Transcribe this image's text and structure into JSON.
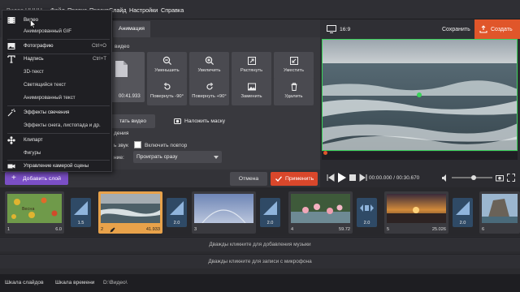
{
  "menubar": {
    "items": [
      "Видео HHHH",
      "Файл",
      "Правка",
      "Проект",
      "Слайд",
      "Настройки",
      "Справка"
    ]
  },
  "topright": {
    "aspect": "16:9",
    "save_label": "Сохранить",
    "create_label": "Создать"
  },
  "dropdown": {
    "items": [
      {
        "label": "Видео",
        "icon": "film-icon",
        "shortcut": ""
      },
      {
        "label": "Анимированный GIF",
        "icon": "",
        "shortcut": ""
      },
      {
        "label": "Фотографию",
        "icon": "image-icon",
        "shortcut": "Ctrl+O"
      },
      {
        "label": "Надпись",
        "icon": "text-icon",
        "shortcut": "Ctrl+T"
      },
      {
        "label": "3D-текст",
        "icon": "",
        "shortcut": ""
      },
      {
        "label": "Светящийся текст",
        "icon": "",
        "shortcut": ""
      },
      {
        "label": "Анимированный текст",
        "icon": "",
        "shortcut": ""
      },
      {
        "label": "Эффекты свечения",
        "icon": "sparkle-icon",
        "shortcut": ""
      },
      {
        "label": "Эффекты снега, листопада и др.",
        "icon": "",
        "shortcut": ""
      },
      {
        "label": "Клипарт",
        "icon": "flower-icon",
        "shortcut": ""
      },
      {
        "label": "Фигуры",
        "icon": "",
        "shortcut": ""
      },
      {
        "label": "Управление камерой сцены",
        "icon": "camera-icon",
        "shortcut": ""
      }
    ]
  },
  "tabs": {
    "animation": "Анимация",
    "video_fragment": "видео"
  },
  "tiles": [
    {
      "label": "Уменьшить",
      "icon": "zoom-out-icon"
    },
    {
      "label": "Увеличить",
      "icon": "zoom-in-icon"
    },
    {
      "label": "Растянуть",
      "icon": "stretch-icon"
    },
    {
      "label": "Уместить",
      "icon": "fit-icon"
    },
    {
      "label": "Повернуть -90°",
      "icon": "rotate-left-icon"
    },
    {
      "label": "Повернуть +90°",
      "icon": "rotate-right-icon"
    },
    {
      "label": "Заменить",
      "icon": "replace-icon"
    },
    {
      "label": "Удалить",
      "icon": "trash-icon"
    }
  ],
  "clip": {
    "duration": "00:41.933"
  },
  "buttons": {
    "edit_video": "тать видео",
    "apply_mask": "Наложить маску"
  },
  "options": {
    "section": "дения",
    "sound": "ь звук",
    "loop_label": "Включить повтор",
    "play_label": "ние:",
    "play_value": "Проиграть сразу"
  },
  "actionbar": {
    "add_layer": "Добавить слой",
    "cancel": "Отмена",
    "apply": "Применить"
  },
  "player": {
    "time": "00:00.000 / 00:30.670"
  },
  "slides": [
    {
      "num": "1",
      "duration": "6.0",
      "scene": "flowers"
    },
    {
      "num": "2",
      "duration": "41.933",
      "scene": "sea"
    },
    {
      "num": "3",
      "duration": "",
      "scene": "sky"
    },
    {
      "num": "4",
      "duration": "59.72",
      "scene": "flamingo"
    },
    {
      "num": "5",
      "duration": "25.026",
      "scene": "sunset"
    },
    {
      "num": "6",
      "duration": "",
      "scene": "rock"
    }
  ],
  "transitions": [
    {
      "duration": "1.5"
    },
    {
      "duration": "2.0"
    },
    {
      "duration": "2.0"
    },
    {
      "duration": "2.0"
    },
    {
      "duration": "2.0"
    }
  ],
  "tracks": {
    "music": "Дважды кликните для добавления музыки",
    "mic": "Дважды кликните для записи с микрофона"
  },
  "statusbar": {
    "slides_tab": "Шкала слайдов",
    "timeline_tab": "Шкала времени",
    "path": "D:\\Видео\\"
  },
  "colors": {
    "accent_orange": "#e0562a",
    "accent_purple": "#7b4fc6",
    "apply_red": "#d9472b",
    "selection_green": "#3ad35a"
  }
}
